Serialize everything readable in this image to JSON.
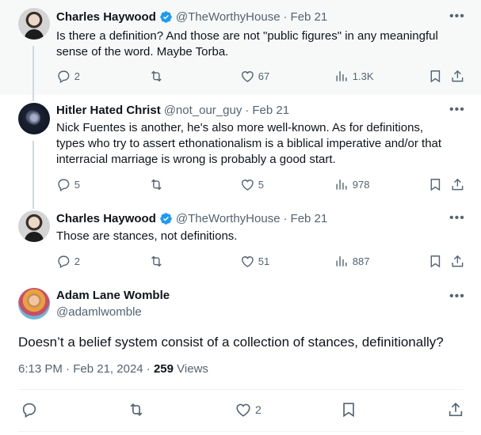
{
  "thread": [
    {
      "name": "Charles Haywood",
      "verified": true,
      "handle": "@TheWorthyHouse",
      "date": "Feb 21",
      "text_lines": [
        "Is there a definition?  And those are not \"public figures\" in any meaningful",
        "sense of the word.  Maybe Torba."
      ],
      "replies": "2",
      "likes": "67",
      "views": "1.3K"
    },
    {
      "name": "Hitler Hated Christ",
      "verified": false,
      "handle": "@not_our_guy",
      "date": "Feb 21",
      "text_lines": [
        "Nick Fuentes is another, he's also more well-known. As for definitions,",
        "types who try to assert ethonationalism is a biblical imperative and/or that",
        "interracial marriage is wrong is probably a good start."
      ],
      "replies": "5",
      "likes": "5",
      "views": "978"
    },
    {
      "name": "Charles Haywood",
      "verified": true,
      "handle": "@TheWorthyHouse",
      "date": "Feb 21",
      "text_lines": [
        "Those are stances, not definitions."
      ],
      "replies": "2",
      "likes": "51",
      "views": "887"
    }
  ],
  "main_tweet": {
    "name": "Adam Lane Womble",
    "handle": "@adamlwomble",
    "text": "Doesn’t a belief system consist of a collection of stances, definitionally?",
    "time": "6:13 PM",
    "date": "Feb 21, 2024",
    "views_count": "259",
    "views_label": "Views",
    "likes": "2"
  },
  "separator": "·",
  "colors": {
    "verified": "#1d9bf0",
    "muted": "#536471",
    "text": "#0f1419"
  }
}
